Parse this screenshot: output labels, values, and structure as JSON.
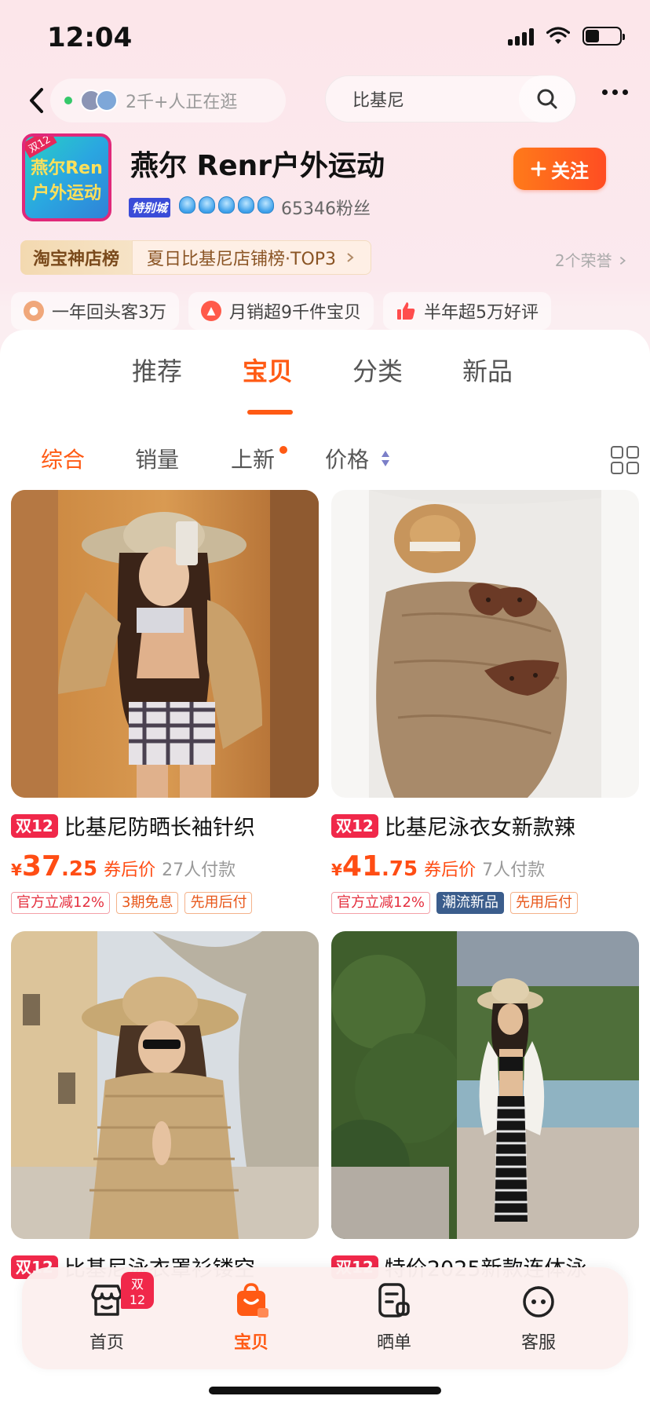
{
  "status_bar": {
    "time": "12:04"
  },
  "topbar": {
    "visitors_text": "2千+人正在逛",
    "search_value": "比基尼"
  },
  "shop": {
    "logo_lines": [
      "燕尔Ren",
      "户外运动"
    ],
    "logo_badge": "双12",
    "name": "燕尔 Renr户外运动",
    "level_tag": "特别城",
    "fans": "65346粉丝",
    "follow_label": "关注",
    "rank_label": "淘宝神店榜",
    "rank_text": "夏日比基尼店铺榜·TOP3",
    "honors": "2个荣誉"
  },
  "features": [
    {
      "icon": "user-icon",
      "text": "一年回头客3万",
      "color": "#f0a77a"
    },
    {
      "icon": "up-arrow-icon",
      "text": "月销超9千件宝贝",
      "color": "#ff5a4a"
    },
    {
      "icon": "thumb-up-icon",
      "text": "半年超5万好评",
      "color": "#ff4d4d"
    }
  ],
  "main_tabs": [
    "推荐",
    "宝贝",
    "分类",
    "新品"
  ],
  "active_main_tab": "宝贝",
  "sort_bar": {
    "items": [
      "综合",
      "销量",
      "上新",
      "价格"
    ],
    "active": "综合"
  },
  "products": [
    {
      "tag": "双12",
      "title": "比基尼防晒长袖针织",
      "currency": "¥",
      "price_int": "37",
      "price_dec": ".25",
      "price_label": "券后价",
      "paid": "27人付款",
      "badges": [
        {
          "text": "官方立减12%",
          "style": "red"
        },
        {
          "text": "3期免息",
          "style": "orange"
        },
        {
          "text": "先用后付",
          "style": "orange"
        }
      ]
    },
    {
      "tag": "双12",
      "title": "比基尼泳衣女新款辣",
      "currency": "¥",
      "price_int": "41",
      "price_dec": ".75",
      "price_label": "券后价",
      "paid": "7人付款",
      "badges": [
        {
          "text": "官方立减12%",
          "style": "red"
        },
        {
          "text": "潮流新品",
          "style": "blue"
        },
        {
          "text": "先用后付",
          "style": "orange"
        }
      ]
    },
    {
      "tag": "双12",
      "title": "比基尼泳衣罩衫镂空"
    },
    {
      "tag": "双12",
      "title": "特价2025新款连体泳"
    }
  ],
  "bottom_nav": {
    "badge": "双12",
    "items": [
      {
        "label": "首页",
        "icon": "home-shop-icon"
      },
      {
        "label": "宝贝",
        "icon": "shopping-bag-icon"
      },
      {
        "label": "晒单",
        "icon": "review-icon"
      },
      {
        "label": "客服",
        "icon": "customer-service-icon"
      }
    ],
    "active": "宝贝"
  },
  "colors": {
    "accent": "#ff5a14",
    "promo_red": "#f0284a",
    "page_bg": "#fbe9ee"
  }
}
